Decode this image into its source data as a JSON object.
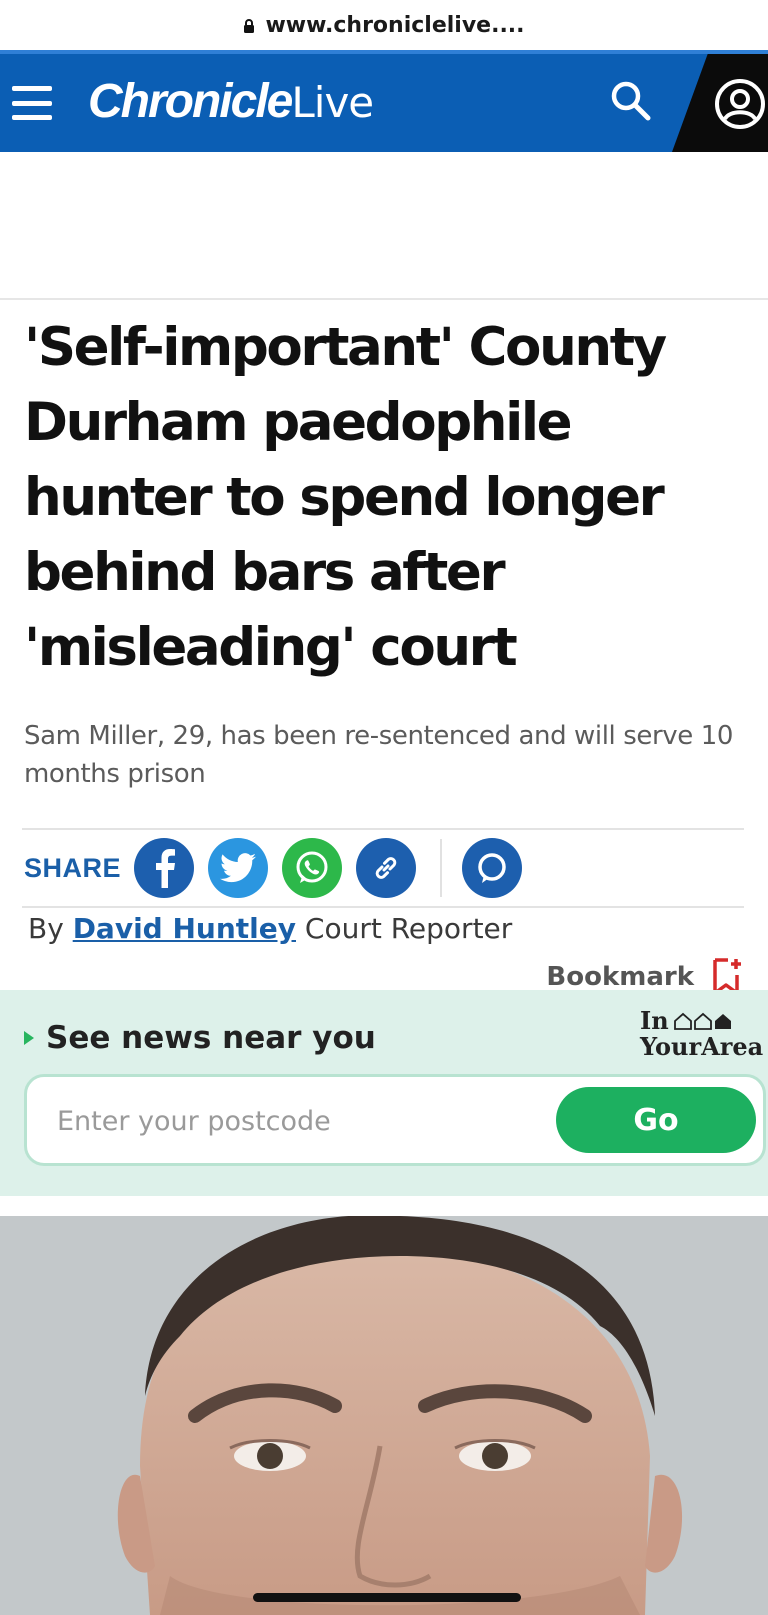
{
  "browser": {
    "url": "www.chroniclelive...."
  },
  "header": {
    "logo_bold": "Chronicle",
    "logo_light": "Live",
    "menu_icon": "hamburger-menu-icon",
    "search_icon": "search-icon",
    "account_icon": "user-account-icon",
    "brand_color": "#0b5eb4"
  },
  "article": {
    "headline": "'Self-important' County Durham paedophile hunter to spend longer behind bars after 'misleading' court",
    "standfirst": "Sam Miller, 29, has been re-sentenced and will serve 10 months prison",
    "share": {
      "label": "SHARE",
      "buttons": [
        "facebook-icon",
        "twitter-icon",
        "whatsapp-icon",
        "copy-link-icon",
        "comments-icon"
      ]
    },
    "byline": {
      "prefix": "By",
      "author": "David Huntley",
      "role": "Court Reporter"
    },
    "bookmark": {
      "label": "Bookmark",
      "icon": "bookmark-icon"
    }
  },
  "near_you": {
    "title": "See news near you",
    "brand_line1": "In",
    "brand_line2": "YourArea",
    "postcode_placeholder": "Enter your postcode",
    "go_label": "Go",
    "accent_color": "#1db060"
  },
  "hero_image": {
    "description_icon": "mugshot-photo"
  }
}
